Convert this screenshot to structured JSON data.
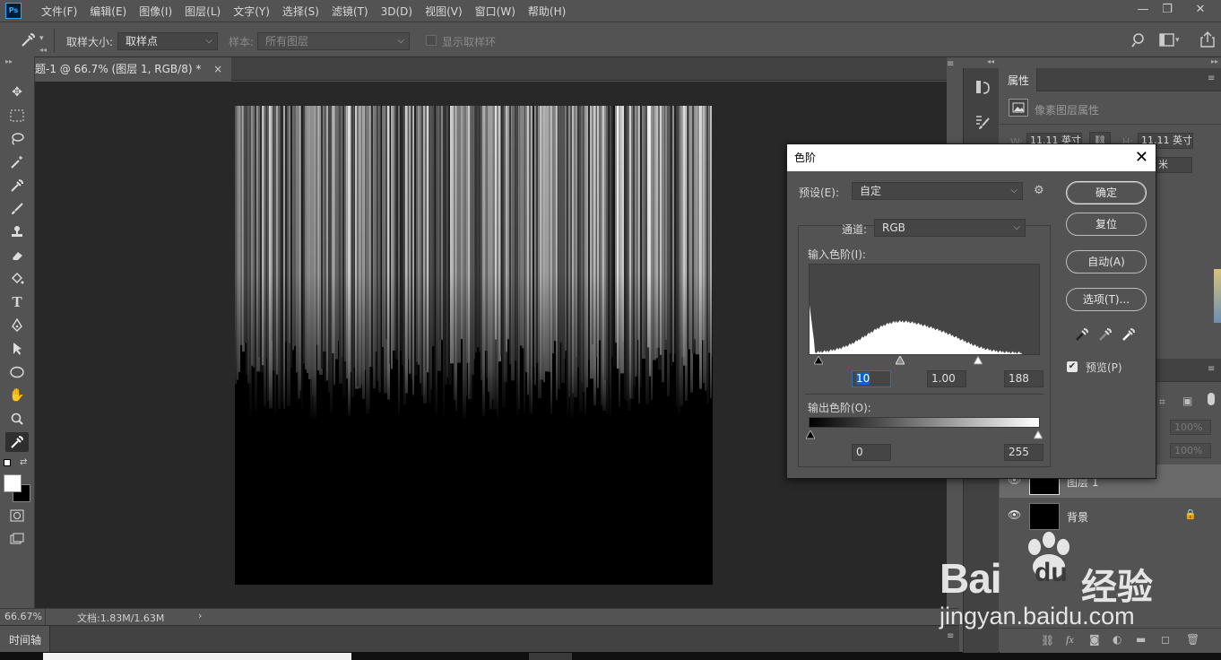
{
  "app": {
    "logo": "Ps"
  },
  "menu": [
    "文件(F)",
    "编辑(E)",
    "图像(I)",
    "图层(L)",
    "文字(Y)",
    "选择(S)",
    "滤镜(T)",
    "3D(D)",
    "视图(V)",
    "窗口(W)",
    "帮助(H)"
  ],
  "window_controls": {
    "minimize": "—",
    "restore": "❐",
    "close": "✕"
  },
  "options": {
    "sample_size_label": "取样大小:",
    "sample_size_value": "取样点",
    "sample_label": "样本:",
    "sample_value": "所有图层",
    "show_ring_label": "显示取样环"
  },
  "document": {
    "tab_title": "题-1 @ 66.7% (图层 1, RGB/8) *",
    "tab_close": "×"
  },
  "status": {
    "zoom": "66.67%",
    "doc_info": "文档:1.83M/1.63M",
    "arrow": "›"
  },
  "timeline": {
    "label": "时间轴"
  },
  "properties": {
    "tab": "属性",
    "header": "像素图层属性",
    "w_label": "W:",
    "w_value": "11.11 英寸",
    "h_label": "H:",
    "h_value": "11.11 英寸",
    "y_value": "米"
  },
  "layers": {
    "opacity_1": "100%",
    "opacity_2": "100%",
    "items": [
      {
        "name": "图层 1"
      },
      {
        "name": "背景"
      }
    ]
  },
  "levels_dialog": {
    "title": "色阶",
    "preset_label": "预设(E):",
    "preset_value": "自定",
    "channel_label": "通道:",
    "channel_value": "RGB",
    "input_label": "输入色阶(I):",
    "output_label": "输出色阶(O):",
    "input_black": "10",
    "input_gamma": "1.00",
    "input_white": "188",
    "output_black": "0",
    "output_white": "255",
    "buttons": {
      "ok": "确定",
      "reset": "复位",
      "auto": "自动(A)",
      "options": "选项(T)..."
    },
    "preview_label": "预览(P)",
    "preview_checked": true
  },
  "watermark": {
    "brand": "Bai",
    "du": "du",
    "cn": "经验",
    "url": "jingyan.baidu.com"
  }
}
